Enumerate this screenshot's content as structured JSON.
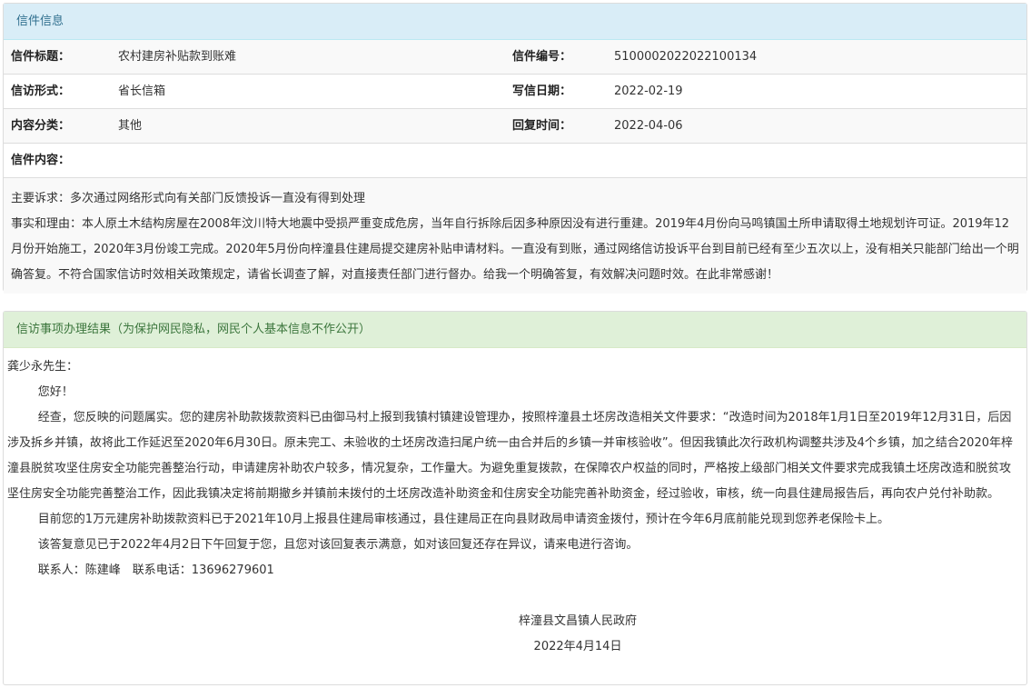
{
  "letter": {
    "section_title": "信件信息",
    "rows": [
      {
        "label1": "信件标题：",
        "value1": "农村建房补贴款到账难",
        "label2": "信件编号：",
        "value2": "5100002022022100134"
      },
      {
        "label1": "信访形式：",
        "value1": "省长信箱",
        "label2": "写信日期：",
        "value2": "2022-02-19"
      },
      {
        "label1": "内容分类：",
        "value1": "其他",
        "label2": "回复时间：",
        "value2": "2022-04-06"
      }
    ],
    "content_label": "信件内容：",
    "body_main": "主要诉求：多次通过网络形式向有关部门反馈投诉一直没有得到处理",
    "body_facts": "事实和理由：本人原土木结构房屋在2008年汶川特大地震中受损严重变成危房，当年自行拆除后因多种原因没有进行重建。2019年4月份向马鸣镇国土所申请取得土地规划许可证。2019年12月份开始施工，2020年3月份竣工完成。2020年5月份向梓潼县住建局提交建房补贴申请材料。一直没有到账，通过网络信访投诉平台到目前已经有至少五次以上，没有相关只能部门给出一个明确答复。不符合国家信访时效相关政策规定，请省长调查了解，对直接责任部门进行督办。给我一个明确答复，有效解决问题时效。在此非常感谢！"
  },
  "result": {
    "section_title": "信访事项办理结果（为保护网民隐私，网民个人基本信息不作公开）",
    "salutation": "龚少永先生：",
    "greeting": "您好！",
    "para1": "经查，您反映的问题属实。您的建房补助款拨款资料已由御马村上报到我镇村镇建设管理办，按照梓潼县土坯房改造相关文件要求：“改造时间为2018年1月1日至2019年12月31日，后因涉及拆乡并镇，故将此工作延迟至2020年6月30日。原未完工、未验收的土坯房改造扫尾户统一由合并后的乡镇一并审核验收”。但因我镇此次行政机构调整共涉及4个乡镇，加之结合2020年梓潼县脱贫攻坚住房安全功能完善整治行动，申请建房补助农户较多，情况复杂，工作量大。为避免重复拨款，在保障农户权益的同时，严格按上级部门相关文件要求完成我镇土坯房改造和脱贫攻坚住房安全功能完善整治工作，因此我镇决定将前期撤乡并镇前未拨付的土坯房改造补助资金和住房安全功能完善补助资金，经过验收，审核，统一向县住建局报告后，再向农户兑付补助款。",
    "para2": "目前您的1万元建房补助拨款资料已于2021年10月上报县住建局审核通过，县住建局正在向县财政局申请资金拨付，预计在今年6月底前能兑现到您养老保险卡上。",
    "para3": "该答复意见已于2022年4月2日下午回复于您，且您对该回复表示满意，如对该回复还存在异议，请来电进行咨询。",
    "contact": "联系人：陈建峰　联系电话：13696279601",
    "signature": "梓潼县文昌镇人民政府",
    "date": "2022年4月14日"
  }
}
